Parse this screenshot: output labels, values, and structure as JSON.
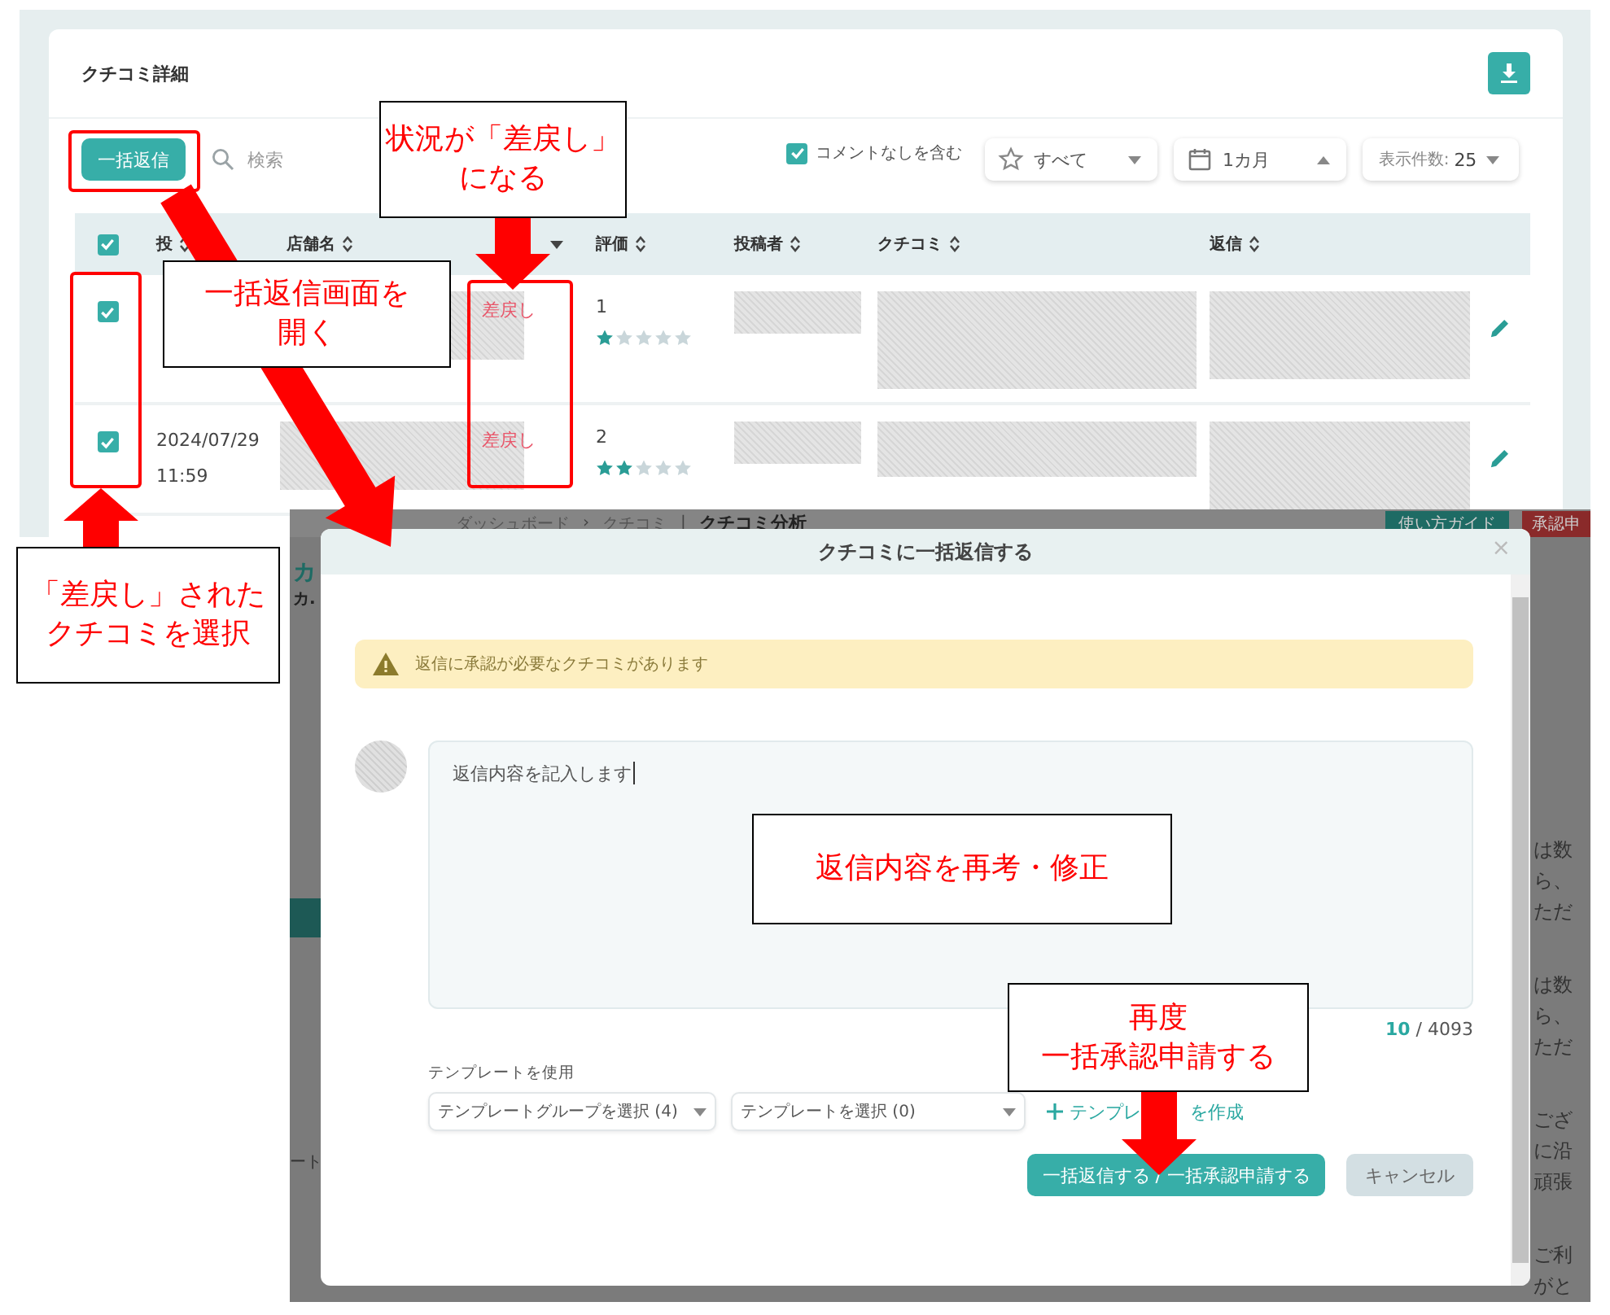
{
  "review_panel": {
    "title": "クチコミ詳細",
    "toolbar": {
      "bulk_reply_button": "一括返信",
      "search": {
        "placeholder": "検索"
      },
      "include_no_comment": {
        "label": "コメントなしを含む",
        "checked": true
      },
      "rating_filter": "すべて",
      "period_filter": "1カ月",
      "page_size_label": "表示件数:",
      "page_size_value": "25"
    },
    "table": {
      "select_all": {
        "checked": true
      },
      "columns": [
        {
          "kind": "sort",
          "label": "投"
        },
        {
          "kind": "sort",
          "label": "店舗名"
        },
        {
          "kind": "menu"
        },
        {
          "kind": "sort",
          "label": "評価"
        },
        {
          "kind": "sort",
          "label": "投稿者"
        },
        {
          "kind": "sort",
          "label": "クチコミ"
        },
        {
          "kind": "sort",
          "label": "返信"
        }
      ],
      "rows": [
        {
          "checked": true,
          "status": "差戻し",
          "rating": "1",
          "stars": 1
        },
        {
          "checked": true,
          "date": "2024/07/29",
          "time": "11:59",
          "status": "差戻し",
          "rating": "2",
          "stars": 2
        }
      ]
    }
  },
  "background_page": {
    "logo": "カ",
    "logo_sub": "カ.",
    "breadcrumb": [
      {
        "kind": "link",
        "text": "ダッシュボード"
      },
      {
        "kind": "separator",
        "text": "›"
      },
      {
        "kind": "link",
        "text": "クチコミ"
      },
      {
        "kind": "separator",
        "text": "|"
      },
      {
        "kind": "current",
        "text": "クチコミ分析"
      }
    ],
    "guide_button": "使い方ガイド",
    "approval_button": "承認申",
    "side_text": "ート",
    "right_fragments": [
      [
        "は数",
        "ら、",
        "ただ"
      ],
      [
        "は数",
        "ら、",
        "ただ"
      ],
      [
        "ござ",
        "に沿",
        "頑張"
      ],
      [
        "ご利",
        "がと"
      ]
    ]
  },
  "dialog": {
    "title": "クチコミに一括返信する",
    "close": "×",
    "warning": "返信に承認が必要なクチコミがあります",
    "reply_text": "返信内容を記入します",
    "char_count": "10",
    "char_limit": "/ 4093",
    "template_label": "テンプレートを使用",
    "template_group_select": "テンプレートグループを選択 (4)",
    "template_select": "テンプレートを選択 (0)",
    "create_template_link": [
      "テンプレ",
      "を作成"
    ],
    "submit_button": "一括返信する / 一括承認申請する",
    "cancel_button": "キャンセル"
  },
  "annotations": [
    {
      "lines": [
        "状況が「差戻し」",
        "になる"
      ]
    },
    {
      "lines": [
        "一括返信画面を",
        "開く"
      ]
    },
    {
      "lines": [
        "「差戻し」された",
        "クチコミを選択"
      ]
    },
    {
      "lines": [
        "返信内容を再考・修正"
      ]
    },
    {
      "lines": [
        "再度",
        "一括承認申請する"
      ]
    }
  ]
}
